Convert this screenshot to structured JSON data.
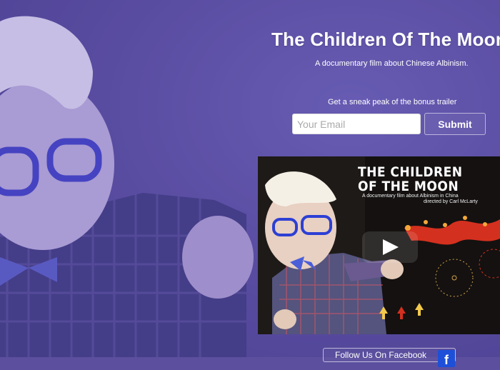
{
  "hero": {
    "title": "The Children Of The Moon",
    "subtitle": "A documentary film about Chinese Albinism."
  },
  "signup": {
    "prompt": "Get a sneak peak of the bonus trailer",
    "email_placeholder": "Your Email",
    "submit_label": "Submit"
  },
  "video": {
    "title_line1": "THE CHILDREN",
    "title_line2": "OF THE MOON",
    "tagline": "A documentary film about Albinism in China",
    "director": "directed by Carl McLarty",
    "play_icon": "play-icon"
  },
  "social": {
    "follow_label": "Follow Us On Facebook",
    "icon": "facebook-icon",
    "icon_glyph": "f"
  },
  "colors": {
    "overlay": "#5b4f9e",
    "facebook": "#1d4fd8"
  }
}
